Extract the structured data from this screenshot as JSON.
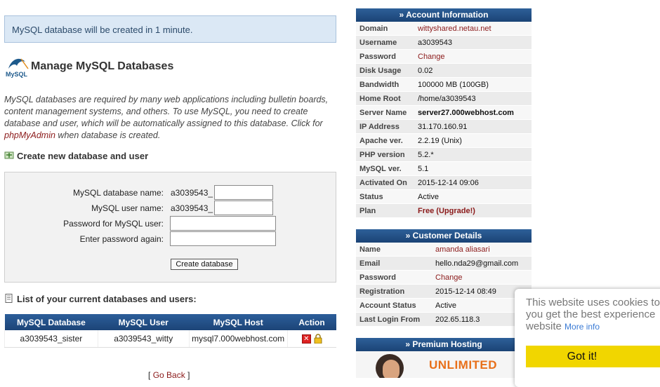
{
  "notice": "MySQL database will be created in 1 minute.",
  "header": {
    "title": "Manage MySQL Databases",
    "logo_text": "MySQL"
  },
  "intro": {
    "text_before": "MySQL databases are required by many web applications including bulletin boards, content management systems, and others. To use MySQL, you need to create database and user, which will be automatically assigned to this database. Click for ",
    "link": "phpMyAdmin",
    "text_after": " when database is created."
  },
  "create_section": {
    "heading": "Create new database and user",
    "db_name_label": "MySQL database name:",
    "db_prefix": "a3039543_",
    "user_name_label": "MySQL user name:",
    "user_prefix": "a3039543_",
    "password_label": "Password for MySQL user:",
    "password_again_label": "Enter password again:",
    "create_button": "Create database"
  },
  "list_section": {
    "heading": "List of your current databases and users:",
    "columns": [
      "MySQL Database",
      "MySQL User",
      "MySQL Host",
      "Action"
    ],
    "rows": [
      {
        "database": "a3039543_sister",
        "user": "a3039543_witty",
        "host": "mysql7.000webhost.com"
      }
    ]
  },
  "go_back": {
    "open": "[",
    "label": "Go Back",
    "close": "]"
  },
  "account": {
    "heading": "» Account Information",
    "rows": [
      {
        "key": "Domain",
        "value": "wittyshared.netau.net"
      },
      {
        "key": "Username",
        "value": "a3039543"
      },
      {
        "key": "Password",
        "value": "Change"
      },
      {
        "key": "Disk Usage",
        "value": "0.02"
      },
      {
        "key": "Bandwidth",
        "value": "100000 MB (100GB)"
      },
      {
        "key": "Home Root",
        "value": "/home/a3039543"
      },
      {
        "key": "Server Name",
        "value": "server27.000webhost.com"
      },
      {
        "key": "IP Address",
        "value": "31.170.160.91"
      },
      {
        "key": "Apache ver.",
        "value": "2.2.19 (Unix)"
      },
      {
        "key": "PHP version",
        "value": "5.2.*"
      },
      {
        "key": "MySQL ver.",
        "value": "5.1"
      },
      {
        "key": "Activated On",
        "value": "2015-12-14 09:06"
      },
      {
        "key": "Status",
        "value": "Active"
      },
      {
        "key": "Plan",
        "value": "Free (Upgrade!)"
      }
    ]
  },
  "customer": {
    "heading": "» Customer Details",
    "rows": [
      {
        "key": "Name",
        "value": "amanda aliasari"
      },
      {
        "key": "Email",
        "value": "hello.nda29@gmail.com"
      },
      {
        "key": "Password",
        "value": "Change"
      },
      {
        "key": "Registration",
        "value": "2015-12-14 08:49"
      },
      {
        "key": "Account Status",
        "value": "Active"
      },
      {
        "key": "Last Login From",
        "value": "202.65.118.3"
      }
    ]
  },
  "premium": {
    "heading": "» Premium Hosting",
    "banner_text": "UNLIMITED"
  },
  "cookie": {
    "line1": "This website uses cookies to",
    "line2": "you get the best experience",
    "line3": "website",
    "more_info": "More info",
    "button": "Got it!"
  },
  "colors": {
    "header_blue": "#1c4477",
    "link_red": "#8b1a1a",
    "cookie_yellow": "#f1d600",
    "notice_bg": "#dbe8f5"
  },
  "icons": [
    "mysql-logo-icon",
    "database-add-icon",
    "document-list-icon",
    "delete-icon",
    "lock-icon"
  ]
}
